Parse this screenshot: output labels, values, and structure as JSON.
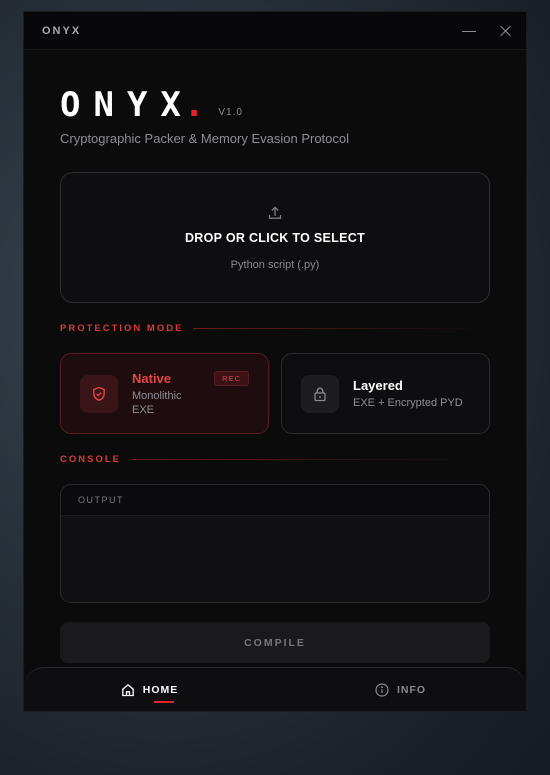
{
  "window": {
    "title": "ONYX"
  },
  "brand": {
    "logo": "ONYX",
    "dot": ".",
    "version": "V1.0",
    "subtitle": "Cryptographic Packer & Memory Evasion Protocol"
  },
  "dropzone": {
    "title": "DROP OR CLICK TO SELECT",
    "subtitle": "Python script (.py)",
    "icon": "upload-icon"
  },
  "protection": {
    "label": "PROTECTION MODE",
    "modes": [
      {
        "name": "Native",
        "desc_line1": "Monolithic",
        "desc_line2": "EXE",
        "badge": "REC",
        "icon": "shield-icon",
        "selected": true
      },
      {
        "name": "Layered",
        "desc_line1": "EXE + Encrypted PYD",
        "icon": "lock-icon",
        "selected": false
      }
    ]
  },
  "console": {
    "label": "CONSOLE",
    "output_label": "OUTPUT"
  },
  "compile": {
    "label": "COMPILE"
  },
  "nav": {
    "home": "HOME",
    "info": "INFO"
  },
  "colors": {
    "accent": "#e3232b",
    "background": "#0b0b0c"
  }
}
